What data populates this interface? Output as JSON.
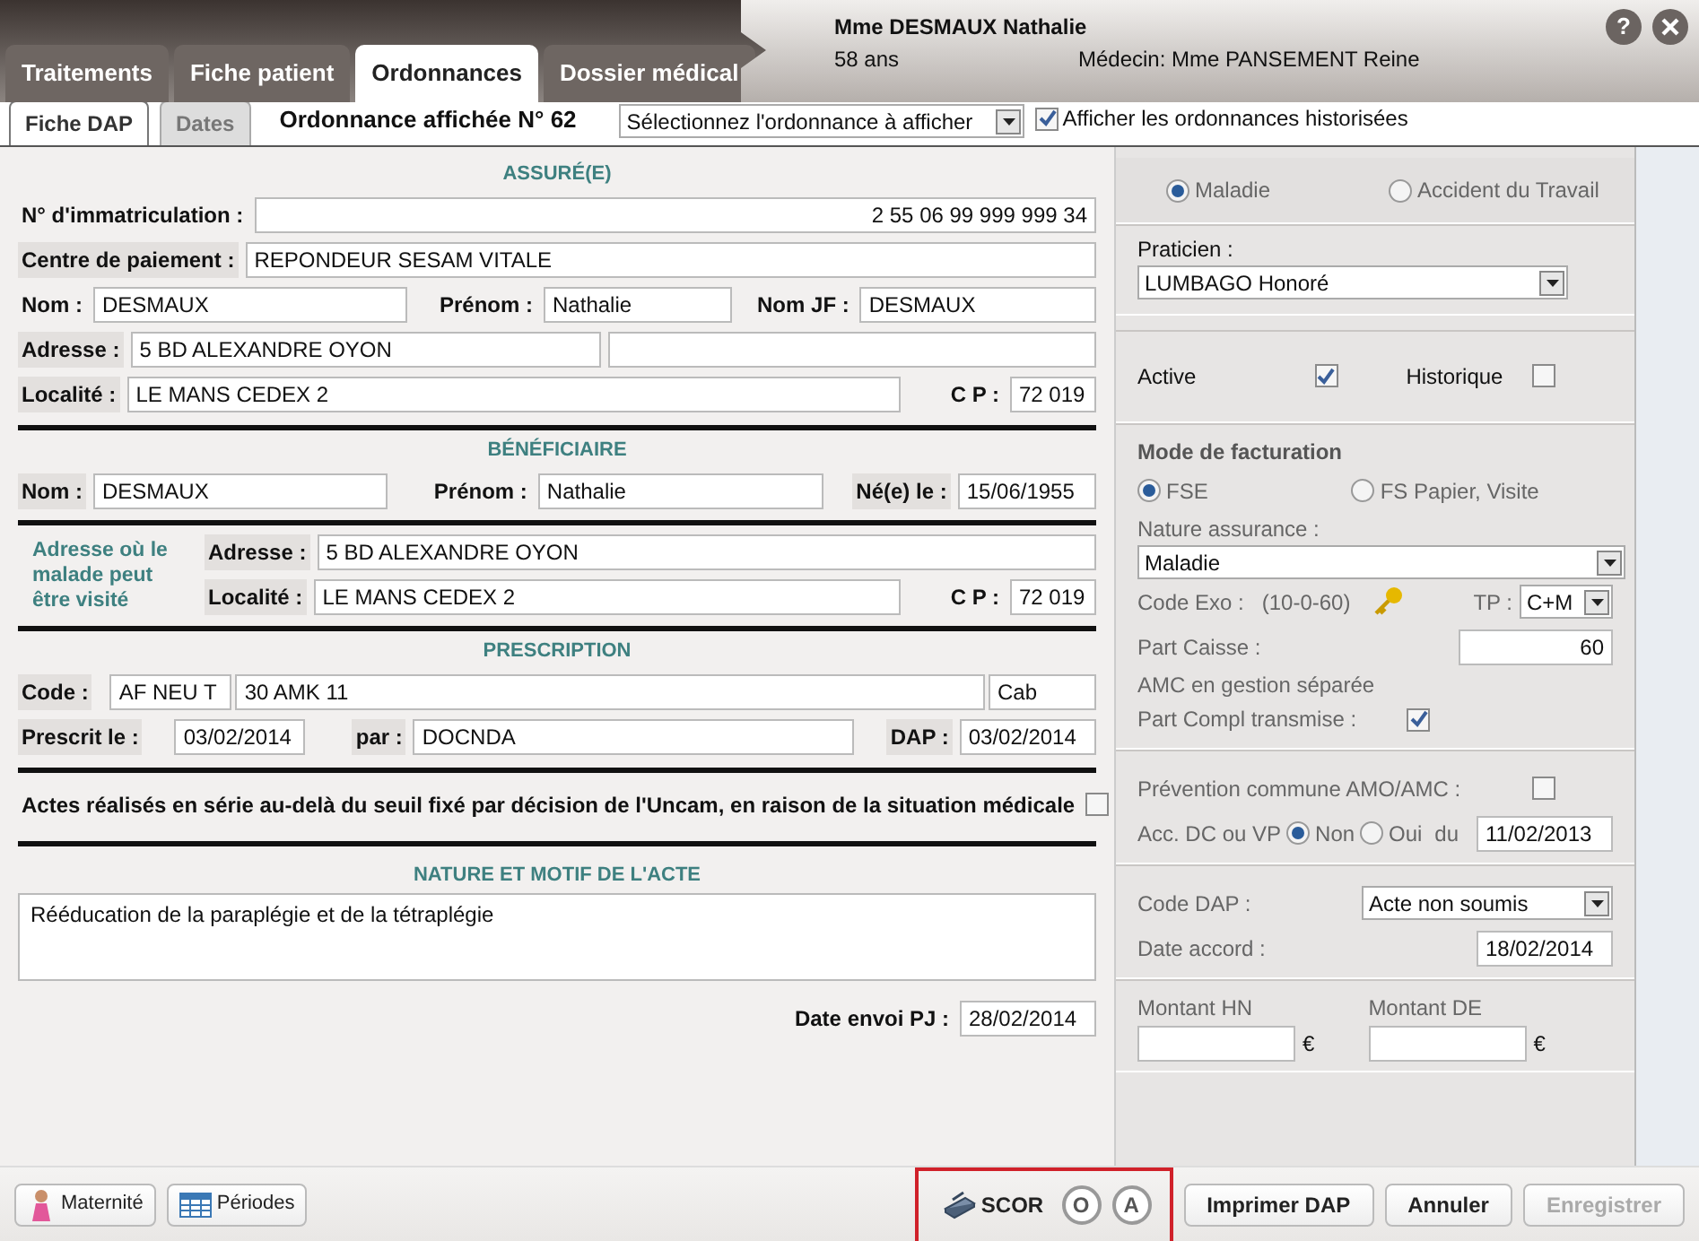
{
  "header": {
    "patient": "Mme DESMAUX Nathalie",
    "age": "58 ans",
    "doctor": "Médecin: Mme PANSEMENT Reine",
    "help": "?"
  },
  "tabs": [
    {
      "label": "Traitements",
      "selected": false
    },
    {
      "label": "Fiche patient",
      "selected": false
    },
    {
      "label": "Ordonnances",
      "selected": true
    },
    {
      "label": "Dossier médical",
      "selected": false
    }
  ],
  "subtabs": [
    {
      "label": "Fiche DAP",
      "selected": true
    },
    {
      "label": "Dates",
      "selected": false
    }
  ],
  "ordonnance_title": "Ordonnance affichée N° 62",
  "ordonnance_select": "Sélectionnez l'ordonnance à afficher",
  "show_history": {
    "label": "Afficher les ordonnances historisées",
    "checked": true
  },
  "assure": {
    "title": "ASSURÉ(E)",
    "immatriculation": {
      "label": "N° d'immatriculation :",
      "value": "2 55 06 99 999 999 34"
    },
    "centre_paiement": {
      "label": "Centre de paiement :",
      "value": "REPONDEUR SESAM VITALE"
    },
    "nom": {
      "label": "Nom :",
      "value": "DESMAUX"
    },
    "prenom": {
      "label": "Prénom :",
      "value": "Nathalie"
    },
    "nom_jf": {
      "label": "Nom JF :",
      "value": "DESMAUX"
    },
    "adresse": {
      "label": "Adresse :",
      "value": "5 BD ALEXANDRE OYON"
    },
    "localite": {
      "label": "Localité :",
      "value": "LE MANS CEDEX 2"
    },
    "cp": {
      "label": "C P :",
      "value": "72 019"
    }
  },
  "beneficiaire": {
    "title": "BÉNÉFICIAIRE",
    "nom": {
      "label": "Nom :",
      "value": "DESMAUX"
    },
    "prenom": {
      "label": "Prénom :",
      "value": "Nathalie"
    },
    "naissance": {
      "label": "Né(e) le :",
      "value": "15/06/1955"
    }
  },
  "visite": {
    "title": "Adresse où le malade peut être visité",
    "adresse": {
      "label": "Adresse :",
      "value": "5 BD ALEXANDRE OYON"
    },
    "localite": {
      "label": "Localité :",
      "value": "LE MANS CEDEX 2"
    },
    "cp": {
      "label": "C P :",
      "value": "72 019"
    }
  },
  "prescription": {
    "title": "PRESCRIPTION",
    "code": {
      "label": "Code :",
      "values": [
        "AF NEU T",
        "30 AMK 11",
        "Cab"
      ]
    },
    "prescrit": {
      "label": "Prescrit le :",
      "value": "03/02/2014"
    },
    "par": {
      "label": "par :",
      "value": "DOCNDA"
    },
    "dap": {
      "label": "DAP :",
      "value": "03/02/2014"
    }
  },
  "serie": {
    "label": "Actes réalisés en série au-delà du seuil fixé par décision de l'Uncam, en raison de la situation médicale",
    "checked": false
  },
  "nature": {
    "title": "NATURE ET MOTIF DE L'ACTE",
    "value": "Rééducation de la paraplégie et de la tétraplégie"
  },
  "date_envoi": {
    "label": "Date envoi PJ :",
    "value": "28/02/2014"
  },
  "right": {
    "type_radios": [
      {
        "label": "Maladie",
        "selected": true
      },
      {
        "label": "Accident du Travail",
        "selected": false
      }
    ],
    "praticien": {
      "label": "Praticien :",
      "value": "LUMBAGO Honoré"
    },
    "active": {
      "label": "Active",
      "checked": true
    },
    "historique": {
      "label": "Historique",
      "checked": false
    },
    "mode_title": "Mode de facturation",
    "mode_radios": [
      {
        "label": "FSE",
        "selected": true
      },
      {
        "label": "FS Papier, Visite",
        "selected": false
      }
    ],
    "nature_assurance": {
      "label": "Nature assurance :",
      "value": "Maladie"
    },
    "code_exo": {
      "label": "Code Exo :",
      "value": "(10-0-60)"
    },
    "tp": {
      "label": "TP :",
      "value": "C+M"
    },
    "part_caisse": {
      "label": "Part Caisse :",
      "value": "60"
    },
    "amc": "AMC en gestion séparée",
    "part_compl": {
      "label": "Part Compl transmise :",
      "checked": true
    },
    "prevention": {
      "label": "Prévention commune AMO/AMC :",
      "checked": false
    },
    "acc": {
      "label": "Acc. DC ou VP",
      "options": [
        {
          "label": "Non",
          "selected": true
        },
        {
          "label": "Oui",
          "selected": false
        }
      ],
      "du_label": "du",
      "du_value": "11/02/2013"
    },
    "code_dap": {
      "label": "Code DAP :",
      "value": "Acte non soumis"
    },
    "date_accord": {
      "label": "Date accord :",
      "value": "18/02/2014"
    },
    "montant_hn": {
      "label": "Montant HN",
      "unit": "€"
    },
    "montant_de": {
      "label": "Montant DE",
      "unit": "€"
    }
  },
  "footer": {
    "left_buttons": [
      {
        "kind": "maternity",
        "label": "Maternité"
      },
      {
        "kind": "periods",
        "label": "Périodes"
      }
    ],
    "scor": "SCOR",
    "circles": [
      "O",
      "A"
    ],
    "buttons": [
      {
        "label": "Imprimer DAP",
        "disabled": false
      },
      {
        "label": "Annuler",
        "disabled": false
      },
      {
        "label": "Enregistrer",
        "disabled": true
      }
    ]
  }
}
